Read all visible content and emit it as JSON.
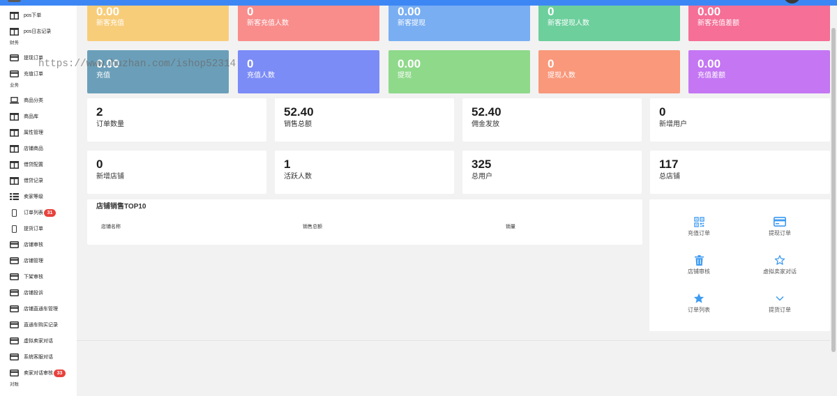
{
  "topbar": {
    "color": "#3d87f5"
  },
  "watermark": "https://www.huzhan.com/ishop52314",
  "sidebar": {
    "badge_color": "#e8413c",
    "items": [
      {
        "icon": "columns-icon",
        "label": "pos下单"
      },
      {
        "icon": "columns-icon",
        "label": "pos日志记录"
      }
    ],
    "sections": [
      {
        "title": "财务",
        "items": [
          {
            "icon": "credit-card-icon",
            "label": "提现订单"
          },
          {
            "icon": "credit-card-icon",
            "label": "充值订单"
          }
        ]
      },
      {
        "title": "业务",
        "items": [
          {
            "icon": "laptop-icon",
            "label": "商品分类"
          },
          {
            "icon": "columns-icon",
            "label": "商品库"
          },
          {
            "icon": "columns-icon",
            "label": "属性管理"
          },
          {
            "icon": "columns-icon",
            "label": "店铺商品"
          },
          {
            "icon": "columns-icon",
            "label": "借贷配置"
          },
          {
            "icon": "columns-icon",
            "label": "借贷记录"
          },
          {
            "icon": "list-icon",
            "label": "卖家等级"
          },
          {
            "icon": "mobile-icon",
            "label": "订单列表",
            "badge": "31"
          },
          {
            "icon": "mobile-icon",
            "label": "提货订单"
          },
          {
            "icon": "credit-card-icon",
            "label": "店铺审核"
          },
          {
            "icon": "credit-card-icon",
            "label": "店铺管理"
          },
          {
            "icon": "credit-card-icon",
            "label": "下架审核"
          },
          {
            "icon": "credit-card-icon",
            "label": "店铺投诉"
          },
          {
            "icon": "credit-card-icon",
            "label": "店铺直通车管理"
          },
          {
            "icon": "credit-card-icon",
            "label": "直通车购买记录"
          },
          {
            "icon": "credit-card-icon",
            "label": "虚拟卖家对话"
          },
          {
            "icon": "credit-card-icon",
            "label": "系统客服对话"
          },
          {
            "icon": "credit-card-icon",
            "label": "卖家对话审核",
            "badge": "33"
          }
        ]
      },
      {
        "title": "对账",
        "items": []
      }
    ]
  },
  "tiles": {
    "row1": [
      {
        "value": "0.00",
        "label": "新客充值",
        "color": "#f8cd7a"
      },
      {
        "value": "0",
        "label": "新客充值人数",
        "color": "#f98d8c"
      },
      {
        "value": "0.00",
        "label": "新客提现",
        "color": "#79aef2"
      },
      {
        "value": "0",
        "label": "新客提现人数",
        "color": "#6ccf9c"
      },
      {
        "value": "0.00",
        "label": "新客充值差额",
        "color": "#f56f97"
      }
    ],
    "row2": [
      {
        "value": "0.00",
        "label": "充值",
        "color": "#6b9fb9"
      },
      {
        "value": "0",
        "label": "充值人数",
        "color": "#7b8cf7"
      },
      {
        "value": "0.00",
        "label": "提现",
        "color": "#8fd98b"
      },
      {
        "value": "0",
        "label": "提现人数",
        "color": "#f9987b"
      },
      {
        "value": "0.00",
        "label": "充值差额",
        "color": "#c476f3"
      }
    ]
  },
  "summary": {
    "row1": [
      {
        "value": "2",
        "label": "订单数量"
      },
      {
        "value": "52.40",
        "label": "销售总额"
      },
      {
        "value": "52.40",
        "label": "佣金发放"
      },
      {
        "value": "0",
        "label": "新增用户"
      }
    ],
    "row2": [
      {
        "value": "0",
        "label": "新增店铺"
      },
      {
        "value": "1",
        "label": "活跃人数"
      },
      {
        "value": "325",
        "label": "总用户"
      },
      {
        "value": "117",
        "label": "总店铺"
      }
    ]
  },
  "top10": {
    "title": "店铺销售TOP10",
    "columns": [
      "店铺名称",
      "销售总额",
      "销量"
    ],
    "rows": []
  },
  "shortcuts": {
    "accent": "#3d9bf2",
    "items": [
      {
        "label": "充值订单",
        "icon": "qrcode-icon"
      },
      {
        "label": "提现订单",
        "icon": "credit-card-icon"
      },
      {
        "label": "店铺审核",
        "icon": "trash-icon"
      },
      {
        "label": "虚拟卖家对话",
        "icon": "star-outline-icon"
      },
      {
        "label": "订单列表",
        "icon": "star-icon"
      },
      {
        "label": "提货订单",
        "icon": "chevron-down-icon"
      }
    ]
  }
}
